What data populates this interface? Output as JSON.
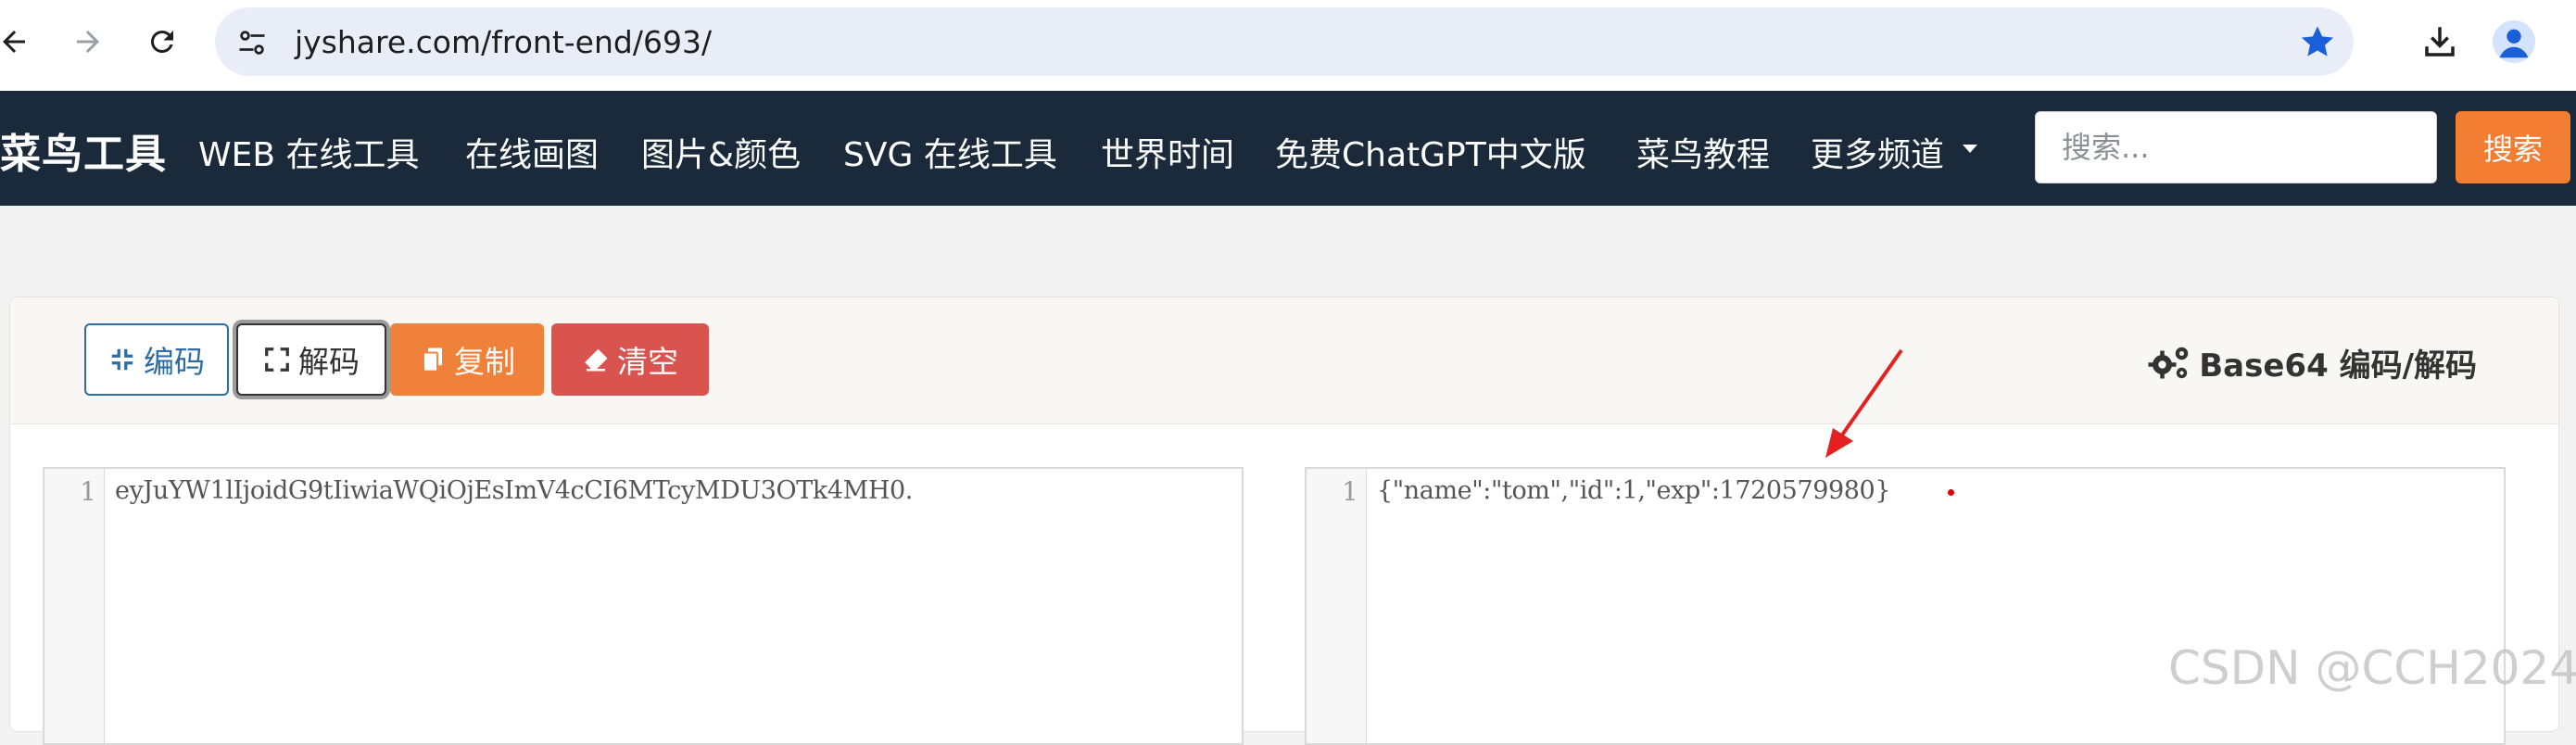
{
  "browser": {
    "url": "jyshare.com/front-end/693/"
  },
  "navbar": {
    "brand": "菜鸟工具",
    "items": [
      {
        "label": "WEB 在线工具"
      },
      {
        "label": "在线画图"
      },
      {
        "label": "图片&颜色"
      },
      {
        "label": "SVG 在线工具"
      },
      {
        "label": "世界时间"
      },
      {
        "label": "免费ChatGPT中文版"
      },
      {
        "label": "菜鸟教程"
      },
      {
        "label": "更多频道"
      }
    ],
    "search_placeholder": "搜索...",
    "search_button": "搜索"
  },
  "toolbar": {
    "encode": "编码",
    "decode": "解码",
    "copy": "复制",
    "clear": "清空"
  },
  "card_title": "Base64 编码/解码",
  "editor_left": {
    "line": "1",
    "text": "eyJuYW1lIjoidG9tIiwiaWQiOjEsImV4cCI6MTcyMDU3OTk4MH0."
  },
  "editor_right": {
    "line": "1",
    "text": "{\"name\":\"tom\",\"id\":1,\"exp\":1720579980}"
  },
  "watermark": "CSDN @CCH2024",
  "colors": {
    "navbar_bg": "#1b2a3a",
    "search_btn": "#f37d32",
    "copy_btn": "#f0813a",
    "clear_btn": "#d9534f",
    "encode_btn_border": "#2e6da4",
    "annotation_arrow": "#e52020",
    "omnibox_bg": "#e9edf7",
    "star": "#1a5fd8"
  },
  "icons": {
    "back": "arrow-left-icon",
    "forward": "arrow-right-icon",
    "reload": "reload-icon",
    "site_settings": "tune-icon",
    "bookmark": "star-icon",
    "download": "download-icon",
    "profile": "profile-icon",
    "encode": "compress-icon",
    "decode": "expand-icon",
    "copy": "copy-icon",
    "clear": "eraser-icon",
    "title": "gears-icon"
  }
}
